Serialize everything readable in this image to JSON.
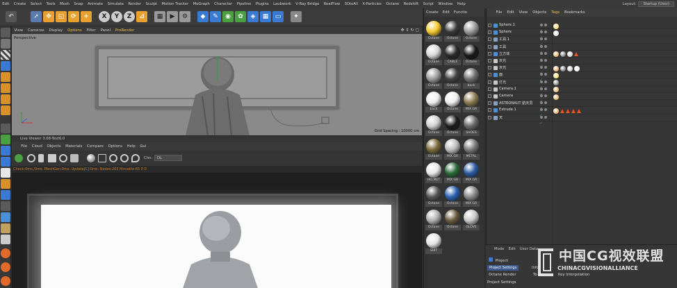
{
  "menubar": {
    "items": [
      "Edit",
      "Create",
      "Select",
      "Tools",
      "Mesh",
      "Snap",
      "Animate",
      "Simulate",
      "Render",
      "Sculpt",
      "Motion Tracker",
      "MoGraph",
      "Character",
      "Pipeline",
      "Plugins",
      "Laubwerk",
      "V-Ray Bridge",
      "RealFlow",
      "3DtoAll",
      "X-Particles",
      "Octane",
      "Redshift",
      "Script",
      "Window",
      "Help"
    ],
    "layout_label": "Layout:",
    "layout_value": "Startup (User)"
  },
  "viewport": {
    "menu": [
      "View",
      "Cameras",
      "Display",
      "Options",
      "Filter",
      "Panel",
      "ProRender"
    ],
    "label": "Perspective",
    "grid_spacing": "Grid Spacing : 10000 cm"
  },
  "live_viewer": {
    "title": "Live Viewer 3.08-Test6.0",
    "menu": [
      "File",
      "Cloud",
      "Objects",
      "Materials",
      "Compare",
      "Options",
      "Help",
      "Gui"
    ],
    "chn_label": "Chn:",
    "chn_value": "DL",
    "status": "Check:0ms./0ms. MeshGen:0ms. Update[C]:0ms. Nodes:203 Movable:65  0 0"
  },
  "materials": {
    "tabs": [
      "Create",
      "Edit",
      "Functio"
    ],
    "items": [
      {
        "label": "Octane",
        "color": "#f4c830"
      },
      {
        "label": "Octane",
        "color": "#3a3a3a"
      },
      {
        "label": "Octane",
        "color": "#9a9a9a"
      },
      {
        "label": "Octane",
        "color": "#d8d8d8"
      },
      {
        "label": "CABLE",
        "color": "#2a2a2a"
      },
      {
        "label": "Octane",
        "color": "#1a1a1a"
      },
      {
        "label": "Octane",
        "color": "#9c9c9c"
      },
      {
        "label": "Octane",
        "color": "#444444"
      },
      {
        "label": "back",
        "color": "#707070"
      },
      {
        "label": "back",
        "color": "#f0f0f0"
      },
      {
        "label": "Octane",
        "color": "#f0f0f0"
      },
      {
        "label": "MIX GR",
        "color": "#8a7a50"
      },
      {
        "label": "Octane",
        "color": "#cfcfcf"
      },
      {
        "label": "Octane",
        "color": "#1c1c1c"
      },
      {
        "label": "SHOES",
        "color": "#6a6a6a"
      },
      {
        "label": "Octane",
        "color": "#7a6a3a"
      },
      {
        "label": "MIX GR",
        "color": "#bdbdbd"
      },
      {
        "label": "METAL",
        "color": "#7a7a7a"
      },
      {
        "label": "HELMET",
        "color": "#e8e8e8"
      },
      {
        "label": "MIX GR",
        "color": "#2a6a3a"
      },
      {
        "label": "MIX GR",
        "color": "#2a5aa0"
      },
      {
        "label": "Octane",
        "color": "#555555"
      },
      {
        "label": "Octane",
        "color": "#2a60b0"
      },
      {
        "label": "MIX GR",
        "color": "#888888"
      },
      {
        "label": "Octane",
        "color": "#b0b0b0"
      },
      {
        "label": "Octane",
        "color": "#6a5a40"
      },
      {
        "label": "GLOVE",
        "color": "#c8c8c8"
      },
      {
        "label": "SUIT",
        "color": "#e6e6e6"
      }
    ]
  },
  "objects": {
    "menu": [
      "File",
      "Edit",
      "View",
      "Objects",
      "Tags",
      "Bookmarks"
    ],
    "rows": [
      {
        "name": "Sphere.1",
        "icon": "#4a90d9"
      },
      {
        "name": "Sphere",
        "icon": "#4a90d9"
      },
      {
        "name": "工具.1",
        "icon": "#8aa0c0"
      },
      {
        "name": "工具",
        "icon": "#8aa0c0"
      },
      {
        "name": "立方体",
        "icon": "#4a90d9"
      },
      {
        "name": "灰光",
        "icon": "#c8c8c8"
      },
      {
        "name": "灰光",
        "icon": "#c8c8c8"
      },
      {
        "name": "面",
        "icon": "#4a90d9"
      },
      {
        "name": "灯光",
        "icon": "#c8c8c8"
      },
      {
        "name": "Camera.1",
        "icon": "#c8c8c8"
      },
      {
        "name": "Camera",
        "icon": "#c8c8c8"
      },
      {
        "name": "ASTRONAUT 航天员",
        "icon": "#8aa0c0"
      },
      {
        "name": "Extrude.1",
        "icon": "#4a90d9"
      },
      {
        "name": "天",
        "icon": "#8aa0c0"
      }
    ]
  },
  "attributes": {
    "tabs": [
      "Mode",
      "Edit",
      "User Data"
    ],
    "project": "Project",
    "project_settings_btn": "Project Settings",
    "info_label": "Info",
    "octane_render": "Octane Render",
    "todo": "To Do",
    "key_interp": "Key Interpolation",
    "section": "Project Settings"
  },
  "watermark": {
    "cn": "中国CG视效联盟",
    "en": "CHINACGVISIONALLIANCE"
  }
}
